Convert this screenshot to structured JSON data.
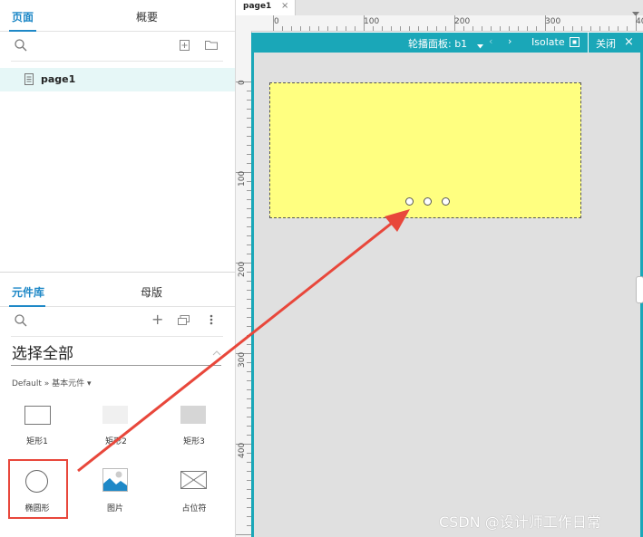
{
  "left_panel": {
    "top_tabs": {
      "pages": "页面",
      "outline": "概要"
    },
    "page_item": "page1",
    "bottom_tabs": {
      "library": "元件库",
      "masters": "母版"
    },
    "library_title": "选择全部",
    "breadcrumb": "Default » 基本元件 ▾",
    "widgets": [
      {
        "label": "矩形1"
      },
      {
        "label": "矩形2"
      },
      {
        "label": "矩形3"
      },
      {
        "label": "椭圆形"
      },
      {
        "label": "图片"
      },
      {
        "label": "占位符"
      }
    ]
  },
  "editor": {
    "tab_name": "page1",
    "ruler_top": [
      "0",
      "100",
      "200",
      "300",
      "40"
    ],
    "ruler_left": [
      "0",
      "100",
      "200",
      "300",
      "400"
    ],
    "dynamic_panel_bar": {
      "title": "轮播面板: b1",
      "isolate": "Isolate",
      "close": "关闭"
    }
  },
  "watermark": "CSDN @设计师工作日常",
  "colors": {
    "accent": "#1e88c7",
    "teal": "#1aa7b8",
    "highlight": "#e8473b",
    "yellow": "#ffff80"
  }
}
